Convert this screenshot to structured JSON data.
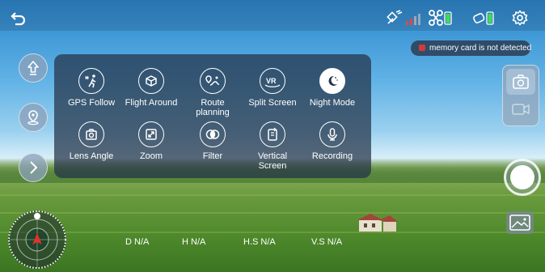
{
  "top_bar": {
    "back_icon": "back-arrow-icon",
    "gps_icon": "gps-satellite-icon",
    "drone_battery_icon": "drone-battery-icon",
    "controller_battery_icon": "controller-battery-icon",
    "settings_icon": "gear-icon"
  },
  "status": {
    "memory_card": "memory card is not detected"
  },
  "menu": {
    "items": [
      {
        "label": "GPS Follow",
        "icon": "gps-follow-icon"
      },
      {
        "label": "Flight Around",
        "icon": "flight-around-icon"
      },
      {
        "label": "Route planning",
        "icon": "route-planning-icon"
      },
      {
        "label": "Split Screen",
        "icon": "vr-split-screen-icon"
      },
      {
        "label": "Night Mode",
        "icon": "night-mode-icon"
      },
      {
        "label": "Lens Angle",
        "icon": "lens-angle-icon"
      },
      {
        "label": "Zoom",
        "icon": "zoom-icon"
      },
      {
        "label": "Filter",
        "icon": "filter-icon"
      },
      {
        "label": "Vertical Screen",
        "icon": "vertical-screen-icon"
      },
      {
        "label": "Recording",
        "icon": "microphone-icon"
      }
    ]
  },
  "telemetry": {
    "distance": "D N/A",
    "height": "H N/A",
    "h_speed": "H.S N/A",
    "v_speed": "V.S N/A"
  },
  "colors": {
    "panel": "#23324680",
    "accent": "#ffffff",
    "alert": "#d23a3a"
  }
}
